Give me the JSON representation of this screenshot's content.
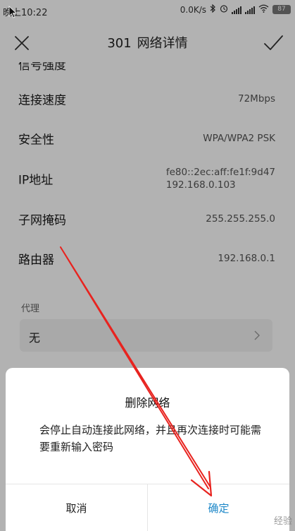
{
  "status_bar": {
    "time": "晚上10:22",
    "network_speed": "0.0K/s",
    "battery": "87"
  },
  "header": {
    "ssid": "301",
    "title": "网络详情"
  },
  "cut_row_label": "信号强度",
  "info_rows": [
    {
      "label": "连接速度",
      "value": "72Mbps"
    },
    {
      "label": "安全性",
      "value": "WPA/WPA2 PSK"
    },
    {
      "label": "IP地址",
      "value": "fe80::2ec:aff:fe1f:9d47",
      "value2": "192.168.0.103"
    },
    {
      "label": "子网掩码",
      "value": "255.255.255.0"
    },
    {
      "label": "路由器",
      "value": "192.168.0.1"
    }
  ],
  "proxy": {
    "label": "代理",
    "value": "无"
  },
  "dialog": {
    "title": "删除网络",
    "message": "会停止自动连接此网络，并且再次连接时可能需要重新输入密码",
    "cancel": "取消",
    "confirm": "确定"
  },
  "watermark": "经验",
  "colors": {
    "accent": "#1e88c8",
    "annotation": "#e8231f"
  },
  "icons": {
    "close": "close-icon",
    "confirm": "checkmark-icon",
    "chevron": "chevron-right-icon"
  }
}
